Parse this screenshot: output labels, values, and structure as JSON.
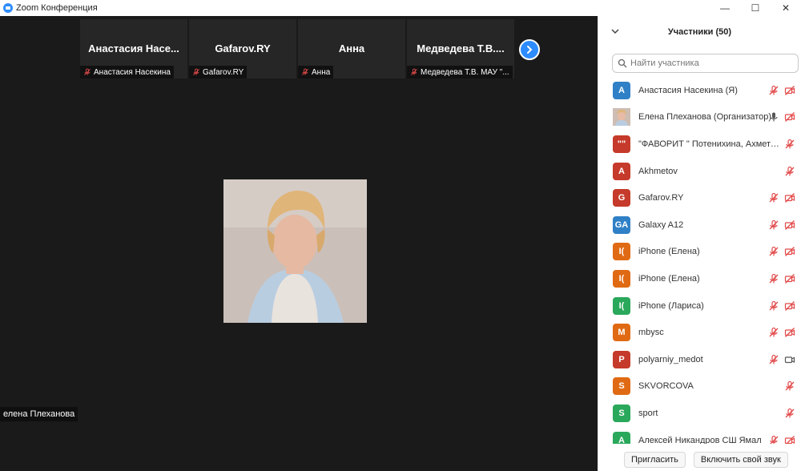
{
  "window": {
    "title": "Zoom Конференция",
    "minimize": "—",
    "maximize": "☐",
    "close": "✕"
  },
  "colors": {
    "zoom_blue": "#2d8cff",
    "muted_red": "#e24a4a",
    "video_bg": "#1a1a1a"
  },
  "thumbnails": [
    {
      "name": "Анастасия Насе...",
      "label": "Анастасия Насекина"
    },
    {
      "name": "Gafarov.RY",
      "label": "Gafarov.RY"
    },
    {
      "name": "Анна",
      "label": "Анна"
    },
    {
      "name": "Медведева Т.В....",
      "label": "Медведева Т.В. МАУ \"..."
    }
  ],
  "speaker": {
    "name": "елена Плеханова"
  },
  "panel": {
    "title": "Участники (50)",
    "search_placeholder": "Найти участника",
    "participants": [
      {
        "initials": "А",
        "color": "#2f80c6",
        "name": "Анастасия Насекина (Я)",
        "mic": "muted",
        "video": "off"
      },
      {
        "initials": "",
        "color": "photo",
        "name": "Елена Плеханова (Организатор)",
        "mic": "on",
        "video": "off"
      },
      {
        "initials": "\"\"",
        "color": "#c53a2a",
        "name": "\"ФАВОРИТ \" Потенихина, Ахметов, ...",
        "mic": "muted",
        "video": "none"
      },
      {
        "initials": "A",
        "color": "#c53a2a",
        "name": "Akhmetov",
        "mic": "muted",
        "video": "none"
      },
      {
        "initials": "G",
        "color": "#c53a2a",
        "name": "Gafarov.RY",
        "mic": "muted",
        "video": "off"
      },
      {
        "initials": "GA",
        "color": "#2f80c6",
        "name": "Galaxy A12",
        "mic": "muted",
        "video": "off"
      },
      {
        "initials": "I(",
        "color": "#e06a13",
        "name": "iPhone (Елена)",
        "mic": "muted",
        "video": "off"
      },
      {
        "initials": "I(",
        "color": "#e06a13",
        "name": "iPhone (Елена)",
        "mic": "muted",
        "video": "off"
      },
      {
        "initials": "I(",
        "color": "#2aa85b",
        "name": "iPhone (Лариса)",
        "mic": "muted",
        "video": "off"
      },
      {
        "initials": "M",
        "color": "#e06a13",
        "name": "mbysc",
        "mic": "muted",
        "video": "off"
      },
      {
        "initials": "P",
        "color": "#c53a2a",
        "name": "polyarniy_medot",
        "mic": "muted",
        "video": "on"
      },
      {
        "initials": "S",
        "color": "#e06a13",
        "name": "SKVORCOVA",
        "mic": "muted",
        "video": "none"
      },
      {
        "initials": "S",
        "color": "#2aa85b",
        "name": "sport",
        "mic": "muted",
        "video": "none"
      },
      {
        "initials": "А",
        "color": "#2aa85b",
        "name": "Алексей Никандров СШ Ямал",
        "mic": "muted",
        "video": "off"
      }
    ]
  },
  "footer": {
    "invite": "Пригласить",
    "unmute": "Включить свой звук"
  }
}
